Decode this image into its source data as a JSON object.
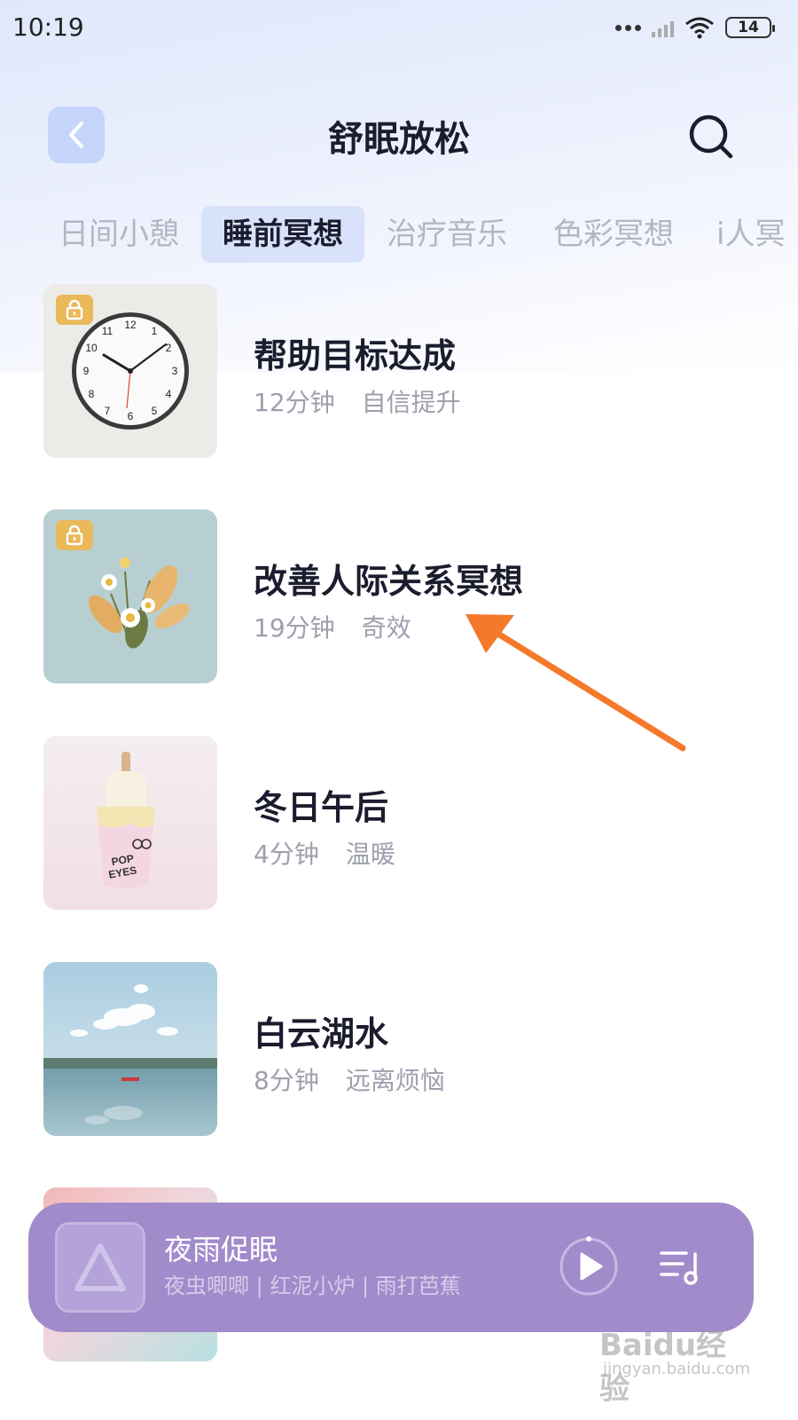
{
  "status_bar": {
    "time": "10:19",
    "battery": "14"
  },
  "header": {
    "title": "舒眠放松"
  },
  "tabs": [
    {
      "label": "日间小憩",
      "active": false
    },
    {
      "label": "睡前冥想",
      "active": true
    },
    {
      "label": "治疗音乐",
      "active": false
    },
    {
      "label": "色彩冥想",
      "active": false
    },
    {
      "label": "i人冥",
      "active": false
    }
  ],
  "items": [
    {
      "title": "帮助目标达成",
      "duration": "12分钟",
      "tag": "自信提升",
      "locked": true
    },
    {
      "title": "改善人际关系冥想",
      "duration": "19分钟",
      "tag": "奇效",
      "locked": true
    },
    {
      "title": "冬日午后",
      "duration": "4分钟",
      "tag": "温暖",
      "locked": false
    },
    {
      "title": "白云湖水",
      "duration": "8分钟",
      "tag": "远离烦恼",
      "locked": false
    }
  ],
  "player": {
    "title": "夜雨促眠",
    "subtitle": "夜虫唧唧 | 红泥小炉 | 雨打芭蕉"
  },
  "watermark": {
    "text": "Baidu经验",
    "sub": "jingyan.baidu.com"
  },
  "colors": {
    "accent_tab": "#d8e3fb",
    "player_bg": "#a18bcb",
    "lock": "#e9b95a",
    "arrow": "#f5792a"
  }
}
